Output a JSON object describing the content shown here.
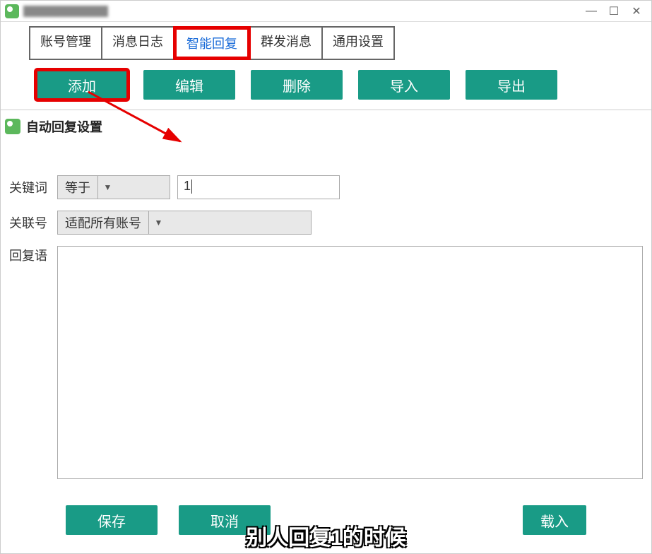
{
  "titlebar": {
    "app_name": "（应用标题）"
  },
  "tabs": [
    {
      "label": "账号管理"
    },
    {
      "label": "消息日志"
    },
    {
      "label": "智能回复",
      "highlighted": true
    },
    {
      "label": "群发消息"
    },
    {
      "label": "通用设置"
    }
  ],
  "toolbar": [
    {
      "label": "添加",
      "highlighted": true
    },
    {
      "label": "编辑"
    },
    {
      "label": "删除"
    },
    {
      "label": "导入"
    },
    {
      "label": "导出"
    }
  ],
  "section": {
    "title": "自动回复设置"
  },
  "form": {
    "keyword_label": "关键词",
    "keyword_operator": "等于",
    "keyword_value": "1",
    "account_label": "关联号",
    "account_value": "适配所有账号",
    "reply_label": "回复语",
    "reply_value": ""
  },
  "buttons": {
    "save": "保存",
    "cancel": "取消",
    "load": "载入"
  },
  "caption": "别人回复1的时候",
  "colors": {
    "teal": "#199b86",
    "highlight_red": "#e60000",
    "link_blue": "#1a6bd8"
  }
}
